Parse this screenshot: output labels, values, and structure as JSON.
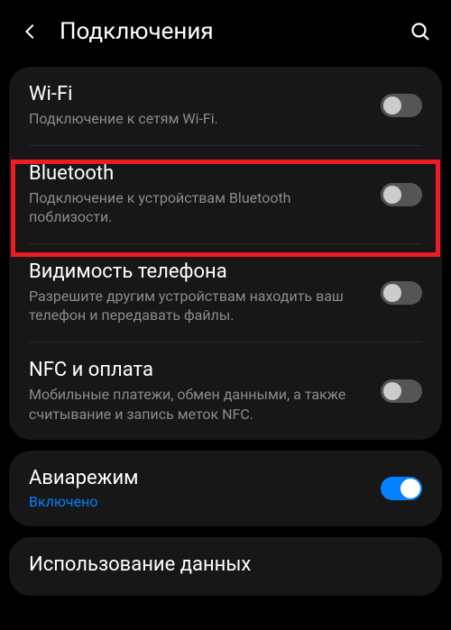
{
  "header": {
    "title": "Подключения"
  },
  "section1": {
    "wifi": {
      "title": "Wi-Fi",
      "desc": "Подключение к сетям Wi-Fi.",
      "enabled": false
    },
    "bluetooth": {
      "title": "Bluetooth",
      "desc": "Подключение к устройствам Bluetooth поблизости.",
      "enabled": false
    },
    "visibility": {
      "title": "Видимость телефона",
      "desc": "Разрешите другим устройствам находить ваш телефон и передавать файлы.",
      "enabled": false
    },
    "nfc": {
      "title": "NFC и оплата",
      "desc": "Мобильные платежи, обмен данными, а также считывание и запись меток NFC.",
      "enabled": false
    }
  },
  "section2": {
    "airplane": {
      "title": "Авиарежим",
      "status": "Включено",
      "enabled": true
    }
  },
  "section3": {
    "data_usage": {
      "title": "Использование данных"
    }
  }
}
